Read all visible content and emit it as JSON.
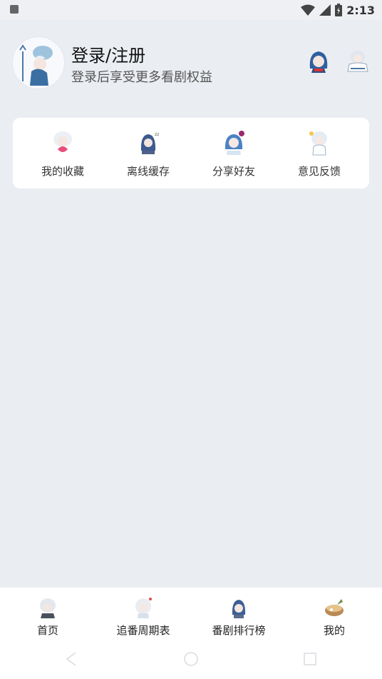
{
  "status_bar": {
    "time": "2:13"
  },
  "profile": {
    "title": "登录/注册",
    "subtitle": "登录后享受更多看剧权益",
    "avatar_icon": "character-avatar-icon",
    "action_icons": [
      "character-hood-icon",
      "character-sitting-icon"
    ]
  },
  "menu": {
    "items": [
      {
        "label": "我的收藏",
        "icon": "favorite-character-icon"
      },
      {
        "label": "离线缓存",
        "icon": "download-character-icon"
      },
      {
        "label": "分享好友",
        "icon": "share-character-icon"
      },
      {
        "label": "意见反馈",
        "icon": "feedback-character-icon"
      }
    ]
  },
  "bottom_nav": {
    "items": [
      {
        "label": "首页",
        "icon": "home-character-icon"
      },
      {
        "label": "追番周期表",
        "icon": "schedule-character-icon"
      },
      {
        "label": "番剧排行榜",
        "icon": "ranking-character-icon"
      },
      {
        "label": "我的",
        "icon": "profile-character-icon"
      }
    ]
  },
  "colors": {
    "background": "#eaedf2",
    "card": "#ffffff",
    "text_primary": "#111111",
    "text_secondary": "#555555"
  }
}
